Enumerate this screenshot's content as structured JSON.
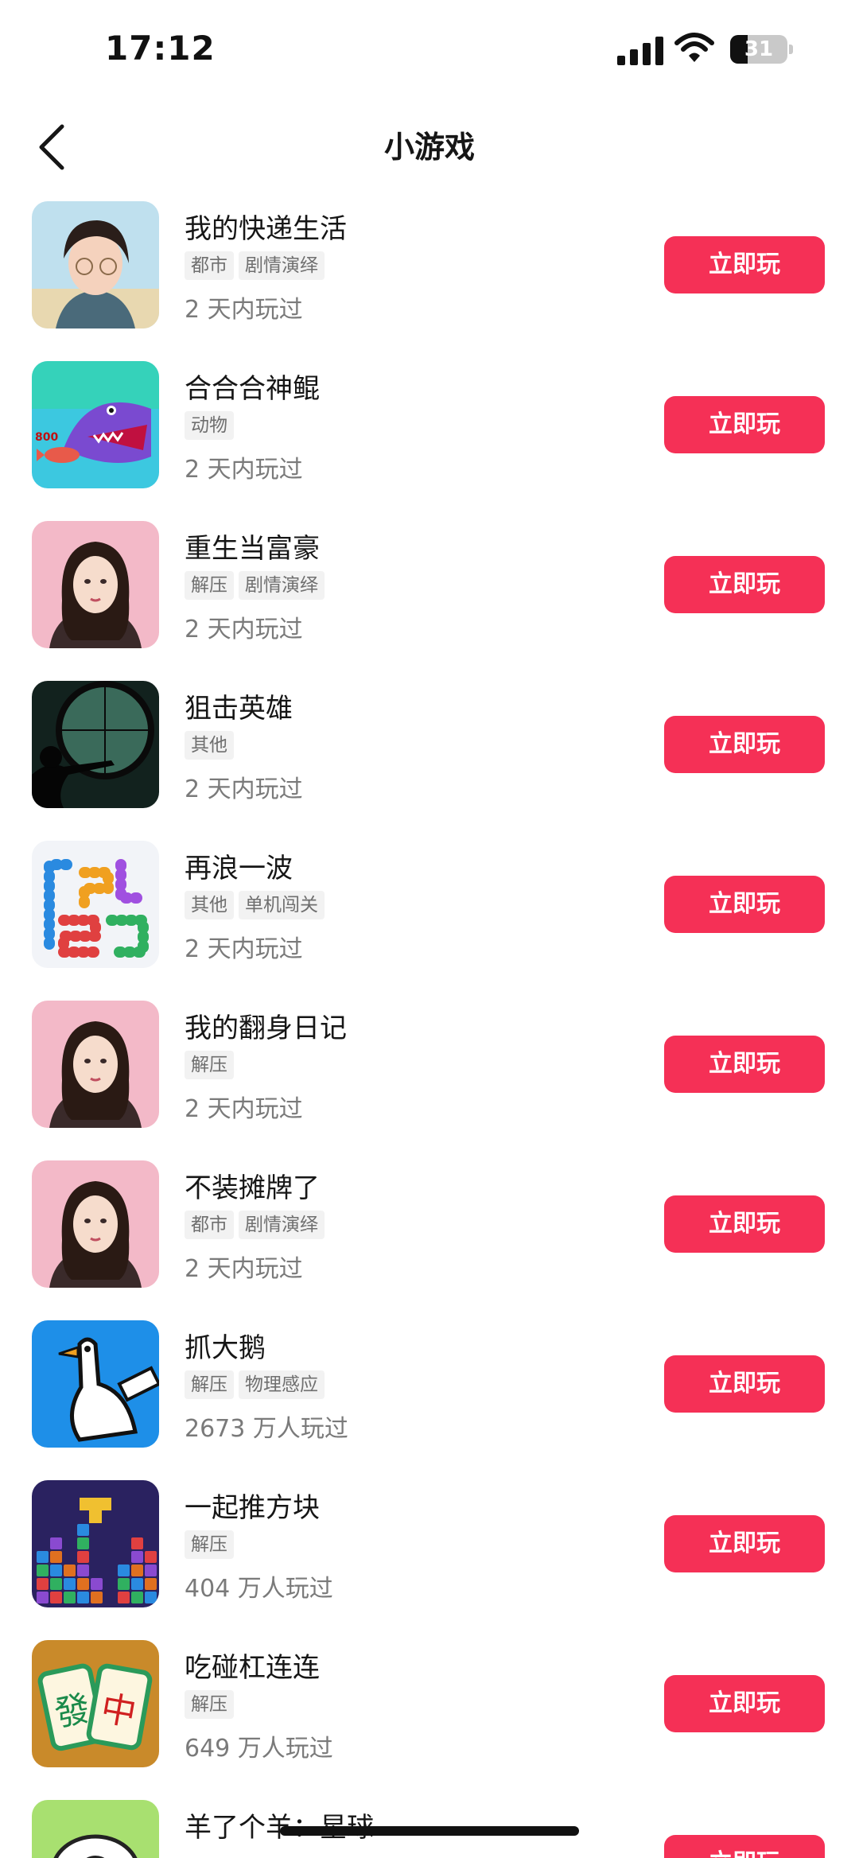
{
  "status_bar": {
    "time": "17:12",
    "battery": "31",
    "battery_level": 0.31
  },
  "header": {
    "title": "小游戏"
  },
  "play_label": "立即玩",
  "games": [
    {
      "title": "我的快递生活",
      "tags": [
        "都市",
        "剧情演绎"
      ],
      "played": "2 天内玩过",
      "icon": "game-icon-man-with-glasses"
    },
    {
      "title": "合合合神鲲",
      "tags": [
        "动物"
      ],
      "played": "2 天内玩过",
      "icon": "game-icon-shark-fish"
    },
    {
      "title": "重生当富豪",
      "tags": [
        "解压",
        "剧情演绎"
      ],
      "played": "2 天内玩过",
      "icon": "game-icon-woman-portrait"
    },
    {
      "title": "狙击英雄",
      "tags": [
        "其他"
      ],
      "played": "2 天内玩过",
      "icon": "game-icon-sniper-scope"
    },
    {
      "title": "再浪一波",
      "tags": [
        "其他",
        "单机闯关"
      ],
      "played": "2 天内玩过",
      "icon": "game-icon-snake-maze"
    },
    {
      "title": "我的翻身日记",
      "tags": [
        "解压"
      ],
      "played": "2 天内玩过",
      "icon": "game-icon-woman-portrait"
    },
    {
      "title": "不装摊牌了",
      "tags": [
        "都市",
        "剧情演绎"
      ],
      "played": "2 天内玩过",
      "icon": "game-icon-woman-portrait"
    },
    {
      "title": "抓大鹅",
      "tags": [
        "解压",
        "物理感应"
      ],
      "played": "2673 万人玩过",
      "icon": "game-icon-goose"
    },
    {
      "title": "一起推方块",
      "tags": [
        "解压"
      ],
      "played": "404 万人玩过",
      "icon": "game-icon-tetris-blocks"
    },
    {
      "title": "吃碰杠连连",
      "tags": [
        "解压"
      ],
      "played": "649 万人玩过",
      "icon": "game-icon-mahjong-tiles"
    },
    {
      "title": "羊了个羊：星球",
      "tags": [],
      "played": "",
      "icon": "game-icon-sheep"
    }
  ]
}
